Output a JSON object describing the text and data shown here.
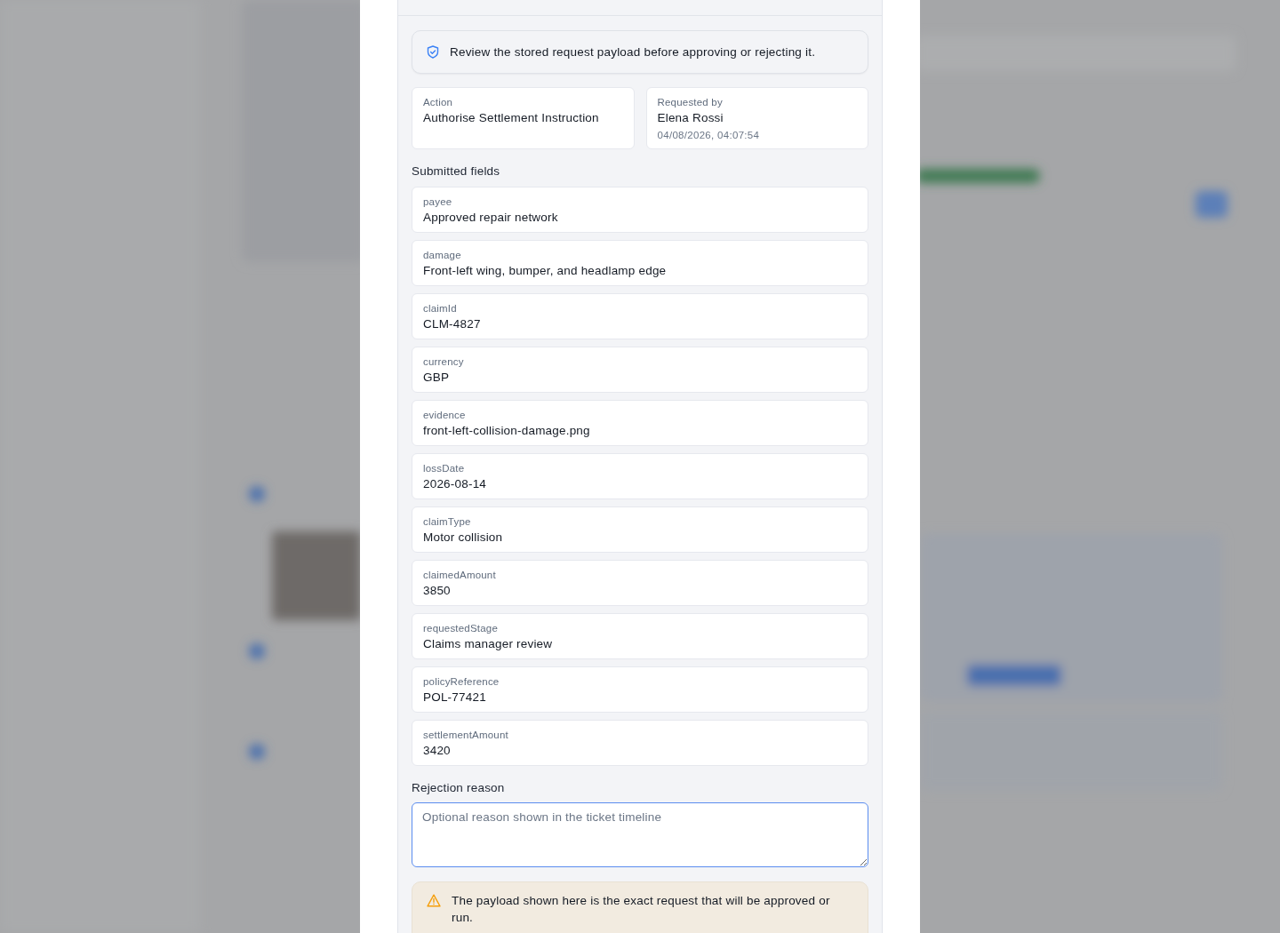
{
  "notice": "Review the stored request payload before approving or rejecting it.",
  "summary": [
    {
      "label": "Action",
      "value": "Authorise Settlement Instruction"
    },
    {
      "label": "Requested by",
      "value": "Elena Rossi",
      "time": "04/08/2026, 04:07:54"
    }
  ],
  "submitted_fields": {
    "heading": "Submitted fields",
    "fields": [
      {
        "label": "payee",
        "value": "Approved repair network"
      },
      {
        "label": "damage",
        "value": "Front-left wing, bumper, and headlamp edge"
      },
      {
        "label": "claimId",
        "value": "CLM-4827"
      },
      {
        "label": "currency",
        "value": "GBP"
      },
      {
        "label": "evidence",
        "value": "front-left-collision-damage.png"
      },
      {
        "label": "lossDate",
        "value": "2026-08-14"
      },
      {
        "label": "claimType",
        "value": "Motor collision"
      },
      {
        "label": "claimedAmount",
        "value": "3850"
      },
      {
        "label": "requestedStage",
        "value": "Claims manager review"
      },
      {
        "label": "policyReference",
        "value": "POL-77421"
      },
      {
        "label": "settlementAmount",
        "value": "3420"
      }
    ]
  },
  "rejection_reason": {
    "label": "Rejection reason",
    "placeholder": "Optional reason shown in the ticket timeline"
  },
  "warning": "The payload shown here is the exact request that will be approved or run."
}
